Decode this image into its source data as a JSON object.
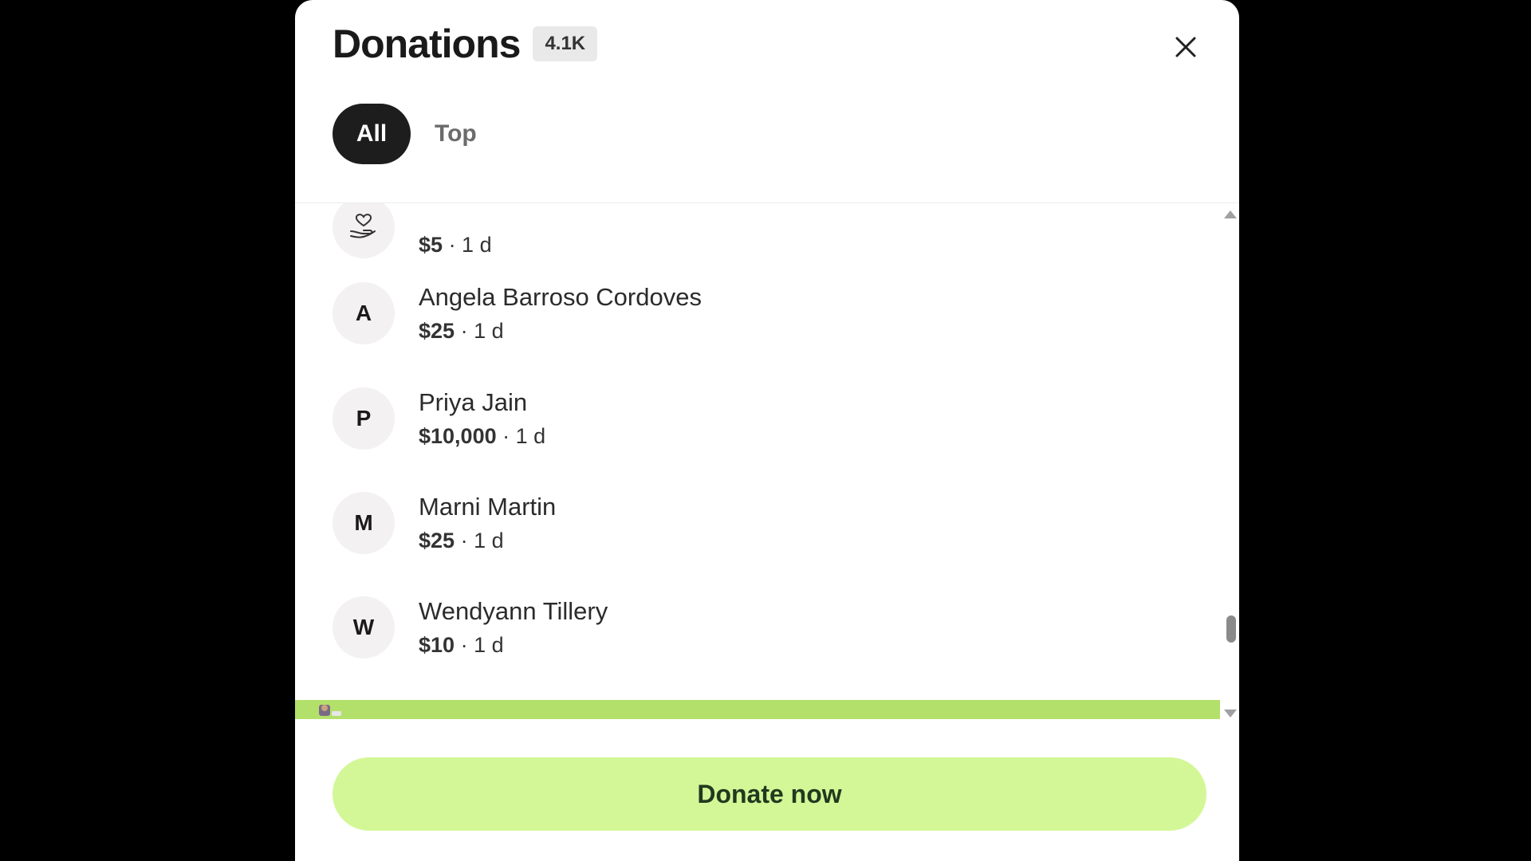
{
  "header": {
    "title": "Donations",
    "count": "4.1K"
  },
  "tabs": [
    {
      "label": "All"
    },
    {
      "label": "Top"
    }
  ],
  "donations": [
    {
      "initial": "",
      "icon": "hand-heart-icon",
      "amount": "$5",
      "time": "· 1 d"
    },
    {
      "initial": "A",
      "name": "Angela Barroso Cordoves",
      "amount": "$25",
      "time": "· 1 d"
    },
    {
      "initial": "P",
      "name": "Priya Jain",
      "amount": "$10,000",
      "time": "· 1 d"
    },
    {
      "initial": "M",
      "name": "Marni Martin",
      "amount": "$25",
      "time": "· 1 d"
    },
    {
      "initial": "W",
      "name": "Wendyann Tillery",
      "amount": "$10",
      "time": "· 1 d"
    }
  ],
  "footer": {
    "donate_label": "Donate now"
  },
  "colors": {
    "accent": "#d3f796",
    "strip": "#b3e06a",
    "dark": "#1d1d1d"
  }
}
